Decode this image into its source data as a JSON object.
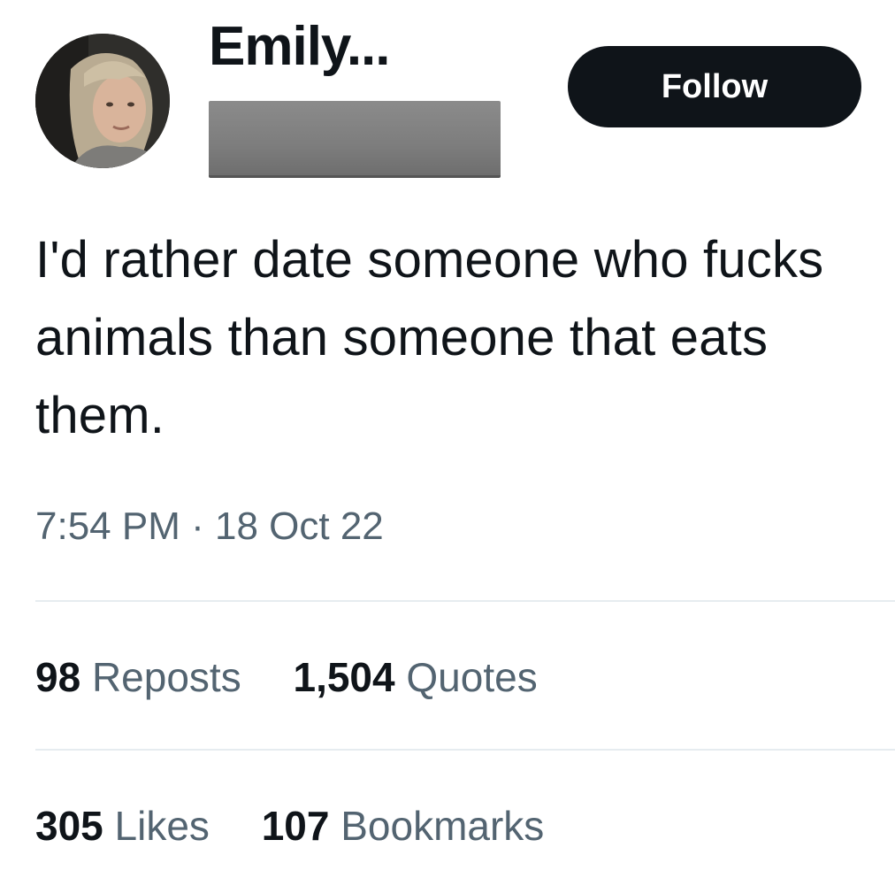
{
  "author": {
    "display_name": "Emily..."
  },
  "follow_button": {
    "label": "Follow"
  },
  "tweet": {
    "text": "I'd rather date someone who fucks animals than someone that eats them.",
    "time": "7:54 PM",
    "separator": "·",
    "date": "18 Oct 22"
  },
  "stats": {
    "reposts": {
      "count": "98",
      "label": "Reposts"
    },
    "quotes": {
      "count": "1,504",
      "label": "Quotes"
    },
    "likes": {
      "count": "305",
      "label": "Likes"
    },
    "bookmarks": {
      "count": "107",
      "label": "Bookmarks"
    }
  },
  "colors": {
    "text": "#0f1419",
    "secondary": "#536471",
    "divider": "#e6ecf0",
    "button_bg": "#0f1419",
    "button_text": "#ffffff",
    "redaction": "#808080"
  }
}
